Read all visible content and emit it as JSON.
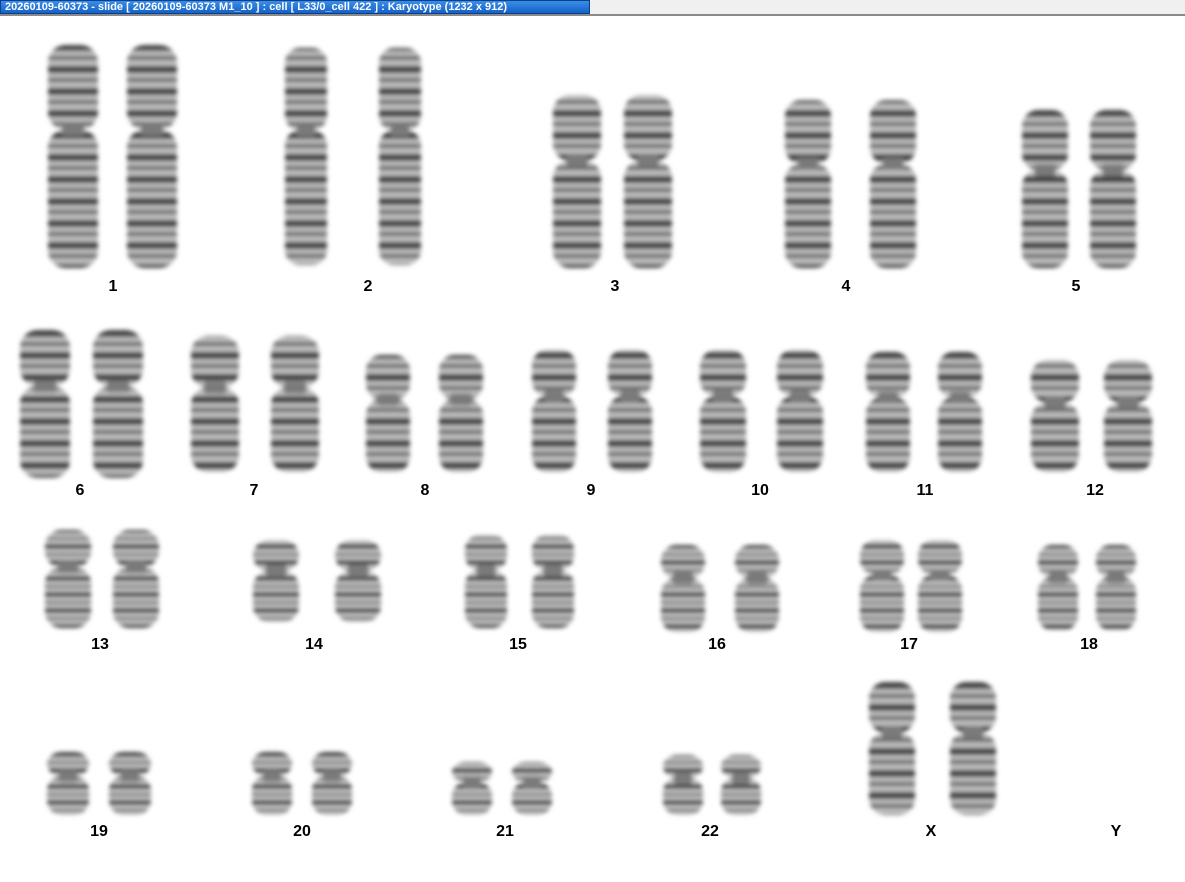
{
  "window": {
    "title": "20260109-60373 - slide [ 20260109-60373 M1_10 ] : cell [ L33/0_cell 422 ] : Karyotype  (1232 x 912)"
  },
  "karyotype": {
    "labels": [
      "1",
      "2",
      "3",
      "4",
      "5",
      "6",
      "7",
      "8",
      "9",
      "10",
      "11",
      "12",
      "13",
      "14",
      "15",
      "16",
      "17",
      "18",
      "19",
      "20",
      "21",
      "22",
      "X",
      "Y"
    ]
  }
}
